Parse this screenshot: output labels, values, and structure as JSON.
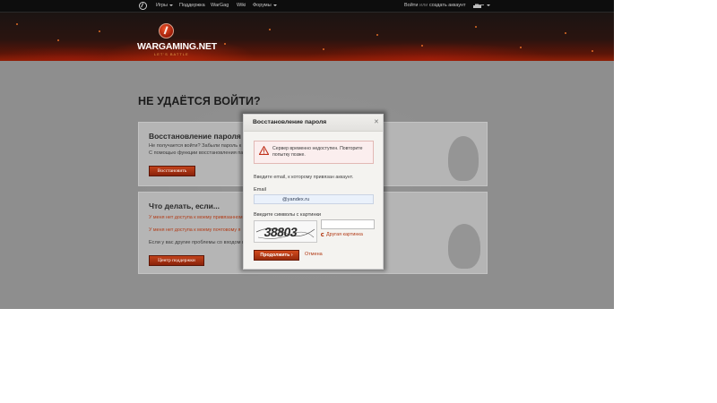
{
  "topnav": {
    "items": [
      {
        "label": "Игры",
        "dropdown": true
      },
      {
        "label": "Поддержка",
        "dropdown": false
      },
      {
        "label": "WarGag",
        "dropdown": false
      },
      {
        "label": "Wiki",
        "dropdown": false
      },
      {
        "label": "Форумы",
        "dropdown": true
      }
    ],
    "login_label": "Войти",
    "or_label": "или",
    "register_label": "создать аккаунт",
    "region_icon": "tank-icon"
  },
  "banner": {
    "brand": "WARGAMING.NET",
    "tagline": "LET'S BATTLE"
  },
  "page": {
    "title": "НЕ УДАЁТСЯ ВОЙТИ?",
    "recovery_card": {
      "title": "Восстановление пароля",
      "line1": "Не получается войти? Забыли пароль к а",
      "line2": "С помощью функции восстановления паро",
      "button": "Восстановить"
    },
    "help_card": {
      "title": "Что делать, если...",
      "link1": "У меня нет доступа к моему привязанном",
      "link2": "У меня нет доступа к моему почтовому я",
      "text": "Если у вас другие проблемы со входом в",
      "button": "Центр поддержки"
    }
  },
  "modal": {
    "title": "Восстановление пароля",
    "close_icon": "close-icon",
    "alert_icon": "warning-icon",
    "alert_text": "Сервер временно недоступен. Повторите попытку позже.",
    "instruction": "Введите email, к которому привязан аккаунт.",
    "email_label": "Email",
    "email_value": "@yandex.ru",
    "captcha_label": "Введите символы с картинки",
    "captcha_text": "38803",
    "captcha_input_value": "",
    "refresh_label": "Другая картинка",
    "continue_label": "Продолжить",
    "cancel_label": "Отмена"
  },
  "colors": {
    "accent": "#b23a15",
    "button": "#c2431c",
    "nav_bg": "#0d0d0d",
    "page_bg": "#8e8e8e"
  }
}
